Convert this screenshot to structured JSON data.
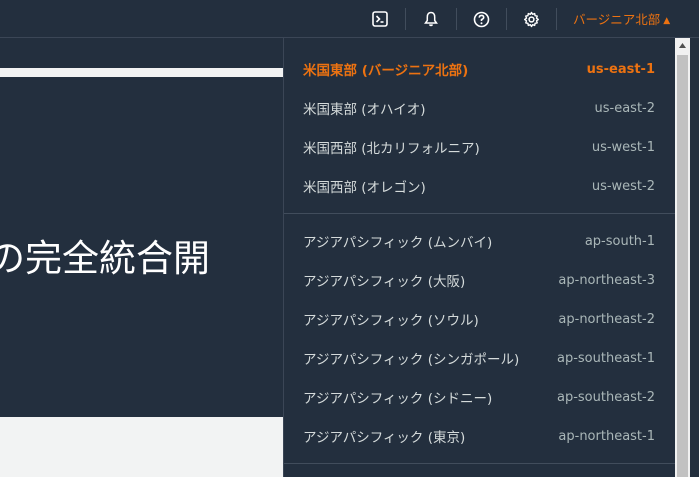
{
  "nav": {
    "icons": [
      "cloudshell-icon",
      "bell-icon",
      "help-icon",
      "gear-icon"
    ],
    "region_label": "バージニア北部",
    "accent_color": "#ec7211"
  },
  "hero": {
    "text": "の完全統合開"
  },
  "regions": {
    "group1": [
      {
        "name": "米国東部 (バージニア北部)",
        "code": "us-east-1",
        "selected": true
      },
      {
        "name": "米国東部 (オハイオ)",
        "code": "us-east-2"
      },
      {
        "name": "米国西部 (北カリフォルニア)",
        "code": "us-west-1"
      },
      {
        "name": "米国西部 (オレゴン)",
        "code": "us-west-2"
      }
    ],
    "group2": [
      {
        "name": "アジアパシフィック (ムンバイ)",
        "code": "ap-south-1"
      },
      {
        "name": "アジアパシフィック (大阪)",
        "code": "ap-northeast-3"
      },
      {
        "name": "アジアパシフィック (ソウル)",
        "code": "ap-northeast-2"
      },
      {
        "name": "アジアパシフィック (シンガポール)",
        "code": "ap-southeast-1"
      },
      {
        "name": "アジアパシフィック (シドニー)",
        "code": "ap-southeast-2"
      },
      {
        "name": "アジアパシフィック (東京)",
        "code": "ap-northeast-1"
      }
    ]
  }
}
